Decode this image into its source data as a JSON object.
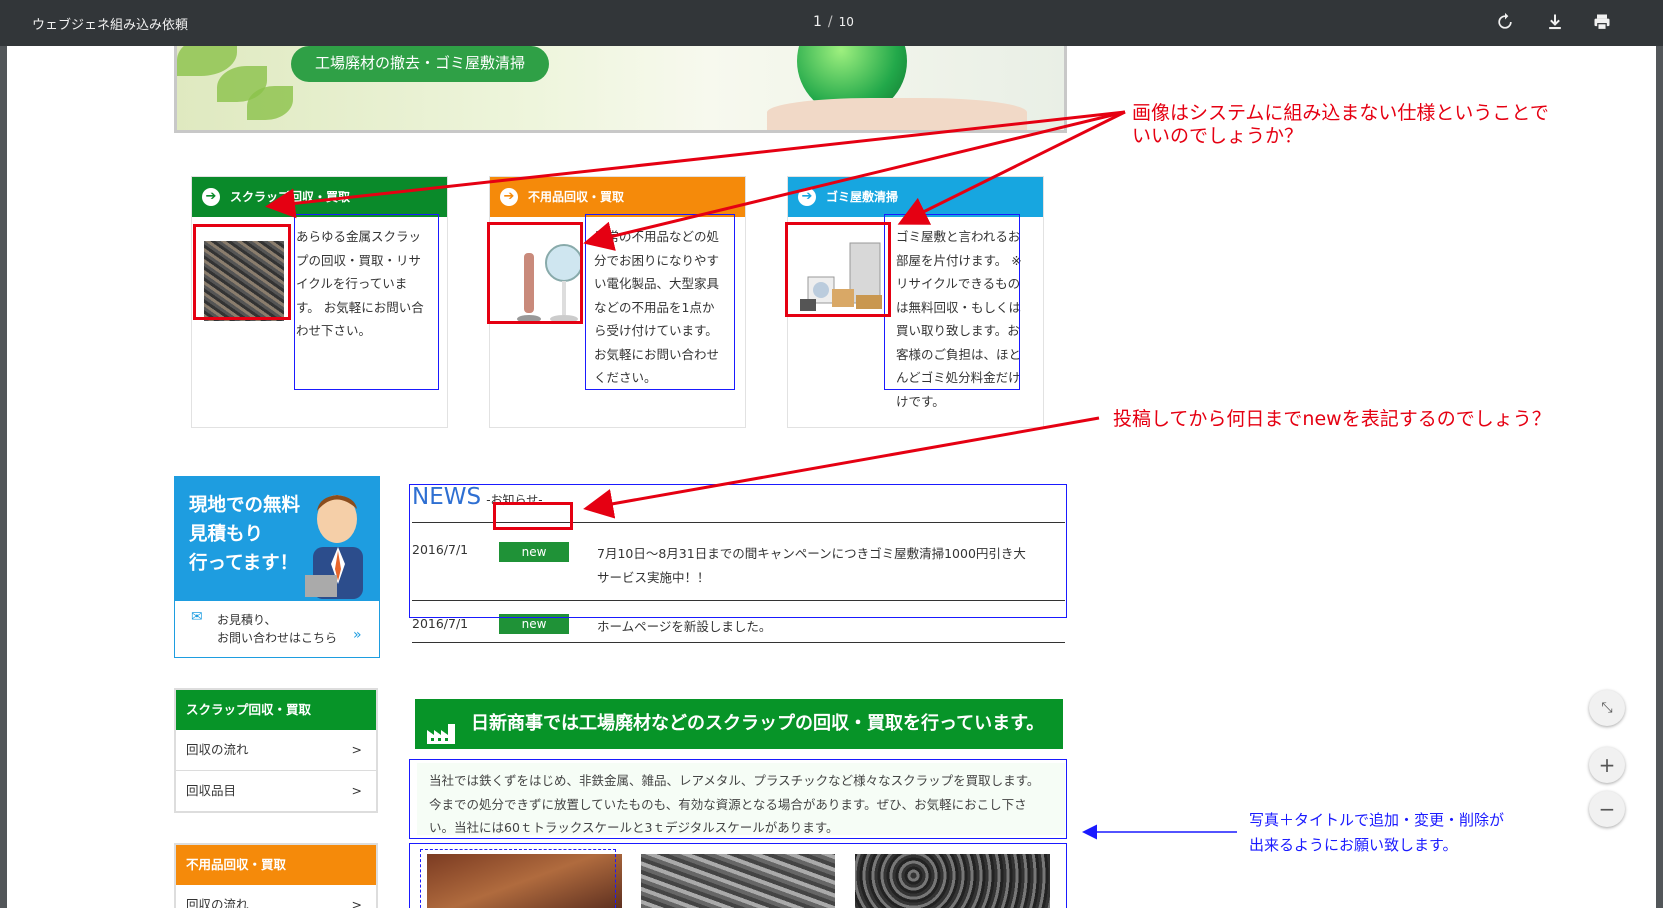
{
  "toolbar": {
    "title": "ウェブジェネ組み込み依頼",
    "current_page": "1",
    "separator": "/",
    "total_pages": "10",
    "icons": [
      "rotate-icon",
      "download-icon",
      "print-icon"
    ]
  },
  "hero": {
    "pill_text": "工場廃材の撤去・ゴミ屋敷清掃"
  },
  "services": [
    {
      "title": "スクラップ回収・買取",
      "color": "#0a8a2a",
      "text": "あらゆる金属スクラップの回収・買取・リサイクルを行っています。 お気軽にお問い合わせ下さい。"
    },
    {
      "title": "不用品回収・買取",
      "color": "#f58a0a",
      "text": "日常の不用品などの処分でお困りになりやすい電化製品、大型家具などの不用品を1点から受け付けています。お気軽にお問い合わせください。"
    },
    {
      "title": "ゴミ屋敷清掃",
      "color": "#17a6e0",
      "text": "ゴミ屋敷と言われるお部屋を片付けます。 ※リサイクルできるものは無料回収・もしくは買い取り致します。お客様のご負担は、ほとんどゴミ処分料金だけけです。"
    }
  ],
  "news": {
    "title": "NEWS",
    "subtitle": "-お知らせ-",
    "items": [
      {
        "date": "2016/7/1",
        "badge": "new",
        "text": "7月10日～8月31日までの間キャンペーンにつきゴミ屋敷清掃1000円引き大サービス実施中！！"
      },
      {
        "date": "2016/7/1",
        "badge": "new",
        "text": "ホームページを新設しました。"
      }
    ]
  },
  "banner": {
    "headline": "現地での無料見積もり行ってます！",
    "line1": "現地での無料",
    "line2": "見積もり",
    "line3": "行ってます！",
    "contact1": "お見積り、",
    "contact2": "お問い合わせはこちら",
    "contact_arrow": "»"
  },
  "sidebar": {
    "sections": [
      {
        "title": "スクラップ回収・買取",
        "color": "#079428",
        "items": [
          {
            "label": "回収の流れ",
            "arrow": ">"
          },
          {
            "label": "回収品目",
            "arrow": ">"
          }
        ]
      },
      {
        "title": "不用品回収・買取",
        "color": "#f58a0a",
        "items": [
          {
            "label": "回収の流れ",
            "arrow": ">"
          }
        ]
      }
    ]
  },
  "main": {
    "heading": "日新商事では工場廃材などのスクラップの回収・買取を行っています。",
    "intro": "当社では鉄くずをはじめ、非鉄金属、雑品、レアメタル、プラスチックなど様々なスクラップを買取します。今までの処分できずに放置していたものも、有効な資源となる場合があります。ぜひ、お気軽におこし下さい。当社には60ｔトラックスケールと3ｔデジタルスケールがあります。"
  },
  "annotations": {
    "image_question": "画像はシステムに組み込まない仕様ということでいいのでしょうか？",
    "image_question_line1": "画像はシステムに組み込まない仕様ということで",
    "image_question_line2": "いいのでしょうか？",
    "news_question": "投稿してから何日までnewを表記するのでしょう？",
    "photo_request_line1": "写真＋タイトルで追加・変更・削除が",
    "photo_request_line2": "出来るようにお願い致します。",
    "red_color": "#e50012",
    "blue_color": "#1a1aff"
  },
  "viewer_controls": {
    "fit": "fit-page-icon",
    "zoom_in": "+",
    "zoom_out": "−"
  }
}
